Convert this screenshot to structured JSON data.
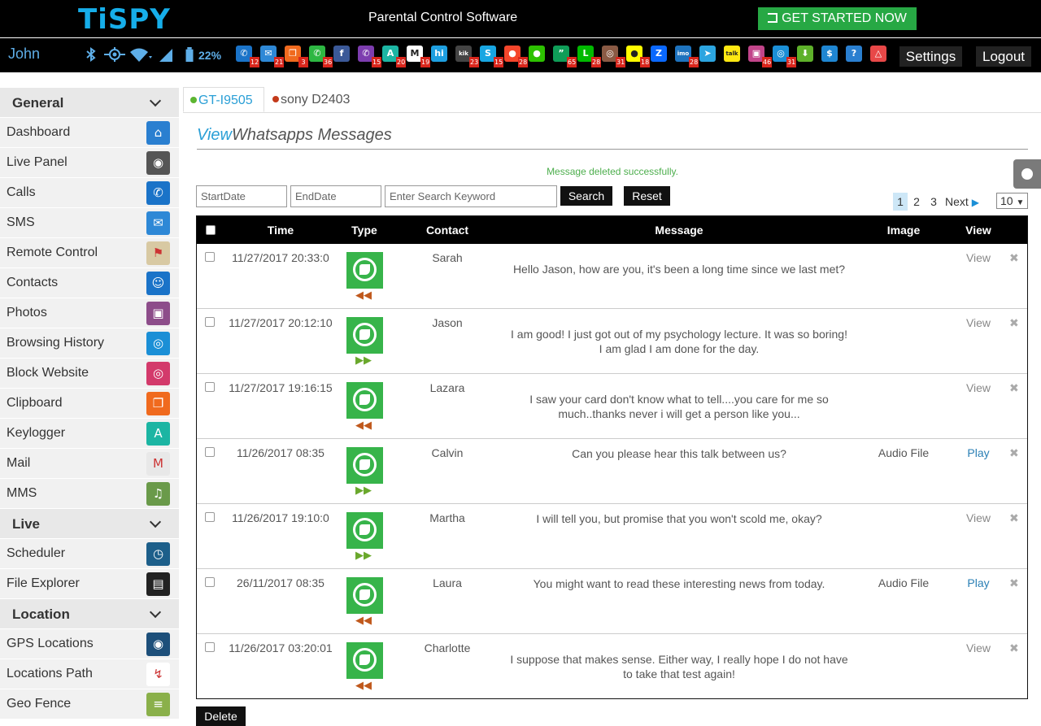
{
  "header": {
    "logo": "TiSPY",
    "tagline": "Parental Control Software",
    "cta": "GET STARTED NOW"
  },
  "iconbar": {
    "user": "John",
    "battery": "22%",
    "apps": [
      {
        "icon": "phone-icon",
        "color": "#1a73c8",
        "glyph": "✆",
        "badge": "12"
      },
      {
        "icon": "mail-icon",
        "color": "#2e88d6",
        "glyph": "✉",
        "badge": "21"
      },
      {
        "icon": "clipboard-icon",
        "color": "#f06a1e",
        "glyph": "❐",
        "badge": "3"
      },
      {
        "icon": "whatsapp-icon",
        "color": "#2db742",
        "glyph": "✆",
        "badge": "36"
      },
      {
        "icon": "facebook-icon",
        "color": "#3b5998",
        "glyph": "f",
        "badge": ""
      },
      {
        "icon": "viber-icon",
        "color": "#7d3daf",
        "glyph": "✆",
        "badge": "15"
      },
      {
        "icon": "keylogger-icon",
        "color": "#1cb5a3",
        "glyph": "A",
        "badge": "20"
      },
      {
        "icon": "gmail-icon",
        "color": "#ffffff",
        "glyph": "M",
        "badge": "19"
      },
      {
        "icon": "hike-icon",
        "color": "#1e9fe0",
        "glyph": "hi",
        "badge": ""
      },
      {
        "icon": "kik-icon",
        "color": "#444444",
        "glyph": "kik",
        "badge": "23"
      },
      {
        "icon": "skype-icon",
        "color": "#18a6e2",
        "glyph": "S",
        "badge": "15"
      },
      {
        "icon": "tinder-icon",
        "color": "#f5462b",
        "glyph": "●",
        "badge": "28"
      },
      {
        "icon": "wechat-icon",
        "color": "#2dc100",
        "glyph": "●",
        "badge": ""
      },
      {
        "icon": "hangouts-icon",
        "color": "#0f9d58",
        "glyph": "”",
        "badge": "65"
      },
      {
        "icon": "line-icon",
        "color": "#00b900",
        "glyph": "L",
        "badge": "28"
      },
      {
        "icon": "instagram-icon",
        "color": "#8a5a44",
        "glyph": "◎",
        "badge": "31"
      },
      {
        "icon": "snapchat-icon",
        "color": "#fffc00",
        "glyph": "●",
        "badge": "18"
      },
      {
        "icon": "zalo-icon",
        "color": "#0a68fe",
        "glyph": "Z",
        "badge": ""
      },
      {
        "icon": "imo-icon",
        "color": "#1e73be",
        "glyph": "imo",
        "badge": "28"
      },
      {
        "icon": "telegram-icon",
        "color": "#2ca5e0",
        "glyph": "➤",
        "badge": ""
      },
      {
        "icon": "kakaotalk-icon",
        "color": "#ffe812",
        "glyph": "talk",
        "badge": ""
      },
      {
        "icon": "photos-icon",
        "color": "#c2458a",
        "glyph": "▣",
        "badge": "46"
      },
      {
        "icon": "browser-icon",
        "color": "#1b8fd6",
        "glyph": "◎",
        "badge": "31"
      },
      {
        "icon": "download-icon",
        "color": "#5eb12a",
        "glyph": "⬇",
        "badge": ""
      },
      {
        "icon": "dollar-icon",
        "color": "#1f86d2",
        "glyph": "$",
        "badge": ""
      },
      {
        "icon": "help-icon",
        "color": "#2a7fd0",
        "glyph": "?",
        "badge": ""
      },
      {
        "icon": "alert-icon",
        "color": "#e84848",
        "glyph": "△",
        "badge": ""
      }
    ],
    "settings": "Settings",
    "logout": "Logout"
  },
  "sidebar": {
    "sections": [
      {
        "title": "General",
        "items": [
          {
            "label": "Dashboard",
            "icon": "home-icon",
            "color": "#2a7fd0",
            "glyph": "⌂"
          },
          {
            "label": "Live Panel",
            "icon": "camera-icon",
            "color": "#555555",
            "glyph": "◉"
          },
          {
            "label": "Calls",
            "icon": "phone-icon",
            "color": "#1a73c8",
            "glyph": "✆"
          },
          {
            "label": "SMS",
            "icon": "envelope-icon",
            "color": "#2e88d6",
            "glyph": "✉"
          },
          {
            "label": "Remote Control",
            "icon": "map-pin-icon",
            "color": "#d8c9a3",
            "glyph": "⚑"
          },
          {
            "label": "Contacts",
            "icon": "contacts-icon",
            "color": "#1a73c8",
            "glyph": "☺"
          },
          {
            "label": "Photos",
            "icon": "photos-icon",
            "color": "#8d4d8a",
            "glyph": "▣"
          },
          {
            "label": "Browsing History",
            "icon": "globe-icon",
            "color": "#1b8fd6",
            "glyph": "◎"
          },
          {
            "label": "Block Website",
            "icon": "block-globe-icon",
            "color": "#d33a6b",
            "glyph": "◎"
          },
          {
            "label": "Clipboard",
            "icon": "clipboard-icon",
            "color": "#f06a1e",
            "glyph": "❐"
          },
          {
            "label": "Keylogger",
            "icon": "keylogger-icon",
            "color": "#1cb5a3",
            "glyph": "A"
          },
          {
            "label": "Mail",
            "icon": "gmail-icon",
            "color": "#e8e8e8",
            "glyph": "M"
          },
          {
            "label": "MMS",
            "icon": "mms-icon",
            "color": "#6a9a4a",
            "glyph": "♫"
          }
        ]
      },
      {
        "title": "Live",
        "items": [
          {
            "label": "Scheduler",
            "icon": "clock-icon",
            "color": "#1d5f8a",
            "glyph": "◷"
          },
          {
            "label": "File Explorer",
            "icon": "sd-card-icon",
            "color": "#222222",
            "glyph": "▤"
          }
        ]
      },
      {
        "title": "Location",
        "items": [
          {
            "label": "GPS Locations",
            "icon": "gps-pin-icon",
            "color": "#1d4f7a",
            "glyph": "◉"
          },
          {
            "label": "Locations Path",
            "icon": "path-icon",
            "color": "#ffffff",
            "glyph": "↯"
          },
          {
            "label": "Geo Fence",
            "icon": "fence-icon",
            "color": "#8ab04a",
            "glyph": "≡"
          }
        ]
      }
    ]
  },
  "tabs": [
    {
      "label": "GT-I9505",
      "dot": "#5cb531"
    },
    {
      "label": "sony D2403",
      "dot": "#c33a1a"
    }
  ],
  "page": {
    "title_view": "View",
    "title_rest": "Whatsapps Messages",
    "success": "Message deleted successfully."
  },
  "filters": {
    "start_placeholder": "StartDate",
    "end_placeholder": "EndDate",
    "keyword_placeholder": "Enter Search Keyword",
    "search": "Search",
    "reset": "Reset"
  },
  "pagination": {
    "pages": [
      "1",
      "2",
      "3"
    ],
    "next": "Next",
    "per_page": "10"
  },
  "table": {
    "headers": {
      "time": "Time",
      "type": "Type",
      "contact": "Contact",
      "message": "Message",
      "image": "Image",
      "view": "View"
    },
    "rows": [
      {
        "time": "11/27/2017 20:33:0",
        "direction": "in",
        "contact": "Sarah",
        "message": "Hello Jason, how are you, it's been a long time since we last met?",
        "image": "",
        "view": "View"
      },
      {
        "time": "11/27/2017 20:12:10",
        "direction": "out",
        "contact": "Jason",
        "message": "I am good! I just got out of my psychology lecture. It was so boring! I am glad I am done for the day.",
        "image": "",
        "view": "View"
      },
      {
        "time": "11/27/2017 19:16:15",
        "direction": "in",
        "contact": "Lazara",
        "message": "I saw your card don't know what to tell....you care for me so much..thanks never i will get a person like you...",
        "image": "",
        "view": "View"
      },
      {
        "time": "11/26/2017 08:35",
        "direction": "out",
        "contact": "Calvin",
        "message": "Can you please hear this talk between us?",
        "image": "Audio File",
        "view": "Play"
      },
      {
        "time": "11/26/2017 19:10:0",
        "direction": "out",
        "contact": "Martha",
        "message": "I will tell you, but promise that you won't scold me, okay?",
        "image": "",
        "view": "View"
      },
      {
        "time": "26/11/2017 08:35",
        "direction": "in",
        "contact": "Laura",
        "message": "You might want to read these interesting news from today.",
        "image": "Audio File",
        "view": "Play"
      },
      {
        "time": "11/26/2017 03:20:01",
        "direction": "in",
        "contact": "Charlotte",
        "message": "I suppose that makes sense. Either way, I really hope I do not have to take that test again!",
        "image": "",
        "view": "View"
      }
    ]
  },
  "delete_label": "Delete"
}
